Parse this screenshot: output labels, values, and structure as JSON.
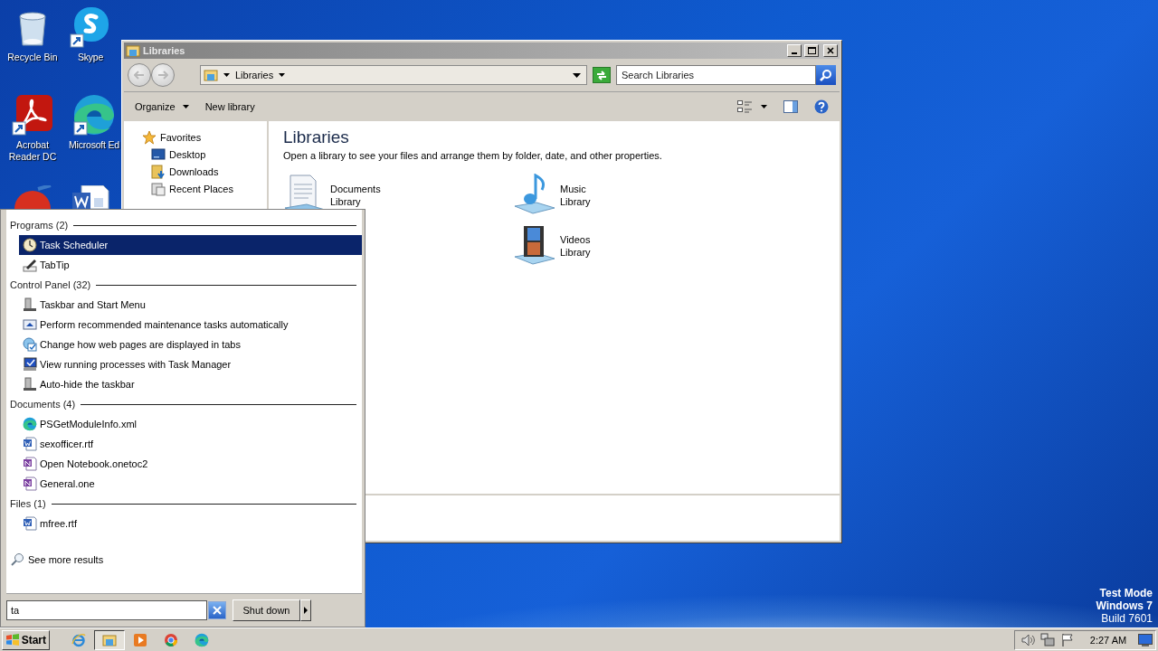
{
  "desktop": {
    "icons": [
      {
        "kind": "recycle-bin",
        "label": "Recycle Bin"
      },
      {
        "kind": "skype",
        "label": "Skype"
      },
      {
        "kind": "acrobat",
        "label": "Acrobat Reader DC"
      },
      {
        "kind": "edge",
        "label": "Microsoft Ed"
      },
      {
        "kind": "ccleaner"
      },
      {
        "kind": "word-doc"
      }
    ],
    "system_text": [
      {
        "text": "Test Mode",
        "bold": true
      },
      {
        "text": "Windows 7",
        "bold": true
      },
      {
        "text": "Build 7601",
        "bold": false
      }
    ]
  },
  "explorer": {
    "title": "Libraries",
    "crumbs": [
      "Libraries"
    ],
    "search_placeholder": "Search Libraries",
    "commands": [
      "Organize",
      "New library"
    ],
    "nav": [
      {
        "label": "Favorites",
        "kind": "star",
        "children": [
          {
            "label": "Desktop",
            "kind": "desktop"
          },
          {
            "label": "Downloads",
            "kind": "downloads"
          },
          {
            "label": "Recent Places",
            "kind": "recent"
          }
        ]
      }
    ],
    "heading": "Libraries",
    "description": "Open a library to see your files and arrange them by folder, date, and other properties.",
    "libraries": [
      {
        "kind": "documents",
        "name": "Documents",
        "sub": "Library"
      },
      {
        "kind": "music",
        "name": "Music",
        "sub": "Library"
      },
      {
        "kind": "videos",
        "name": "Videos",
        "sub": "Library"
      }
    ]
  },
  "start_menu": {
    "groups": [
      {
        "title": "Programs (2)",
        "items": [
          {
            "kind": "clock",
            "label": "Task Scheduler",
            "selected": true
          },
          {
            "kind": "pen",
            "label": "TabTip",
            "selected": false
          }
        ]
      },
      {
        "title": "Control Panel (32)",
        "items": [
          {
            "kind": "taskbar",
            "label": "Taskbar and Start Menu",
            "selected": false
          },
          {
            "kind": "maintenance",
            "label": "Perform recommended maintenance tasks automatically",
            "selected": false
          },
          {
            "kind": "web-options",
            "label": "Change how web pages are displayed in tabs",
            "selected": false
          },
          {
            "kind": "monitor-check",
            "label": "View running processes with Task Manager",
            "selected": false
          },
          {
            "kind": "taskbar",
            "label": "Auto-hide the taskbar",
            "selected": false
          }
        ]
      },
      {
        "title": "Documents (4)",
        "items": [
          {
            "kind": "edge",
            "label": "PSGetModuleInfo.xml",
            "selected": false
          },
          {
            "kind": "word",
            "label": "sexofficer.rtf",
            "selected": false
          },
          {
            "kind": "onenote",
            "label": "Open Notebook.onetoc2",
            "selected": false
          },
          {
            "kind": "onenote",
            "label": "General.one",
            "selected": false
          }
        ]
      },
      {
        "title": "Files (1)",
        "items": [
          {
            "kind": "word",
            "label": "mfree.rtf",
            "selected": false
          }
        ]
      }
    ],
    "see_more": "See more results",
    "search_value": "ta",
    "shutdown": "Shut down"
  },
  "taskbar": {
    "start": "Start",
    "buttons": [
      {
        "kind": "ie",
        "selected": false
      },
      {
        "kind": "explorer",
        "selected": true
      },
      {
        "kind": "media",
        "selected": false
      },
      {
        "kind": "chrome",
        "selected": false
      },
      {
        "kind": "edge",
        "selected": false
      }
    ],
    "tray": [
      {
        "kind": "speaker"
      },
      {
        "kind": "network"
      },
      {
        "kind": "flag"
      }
    ],
    "clock": "2:27 AM"
  }
}
